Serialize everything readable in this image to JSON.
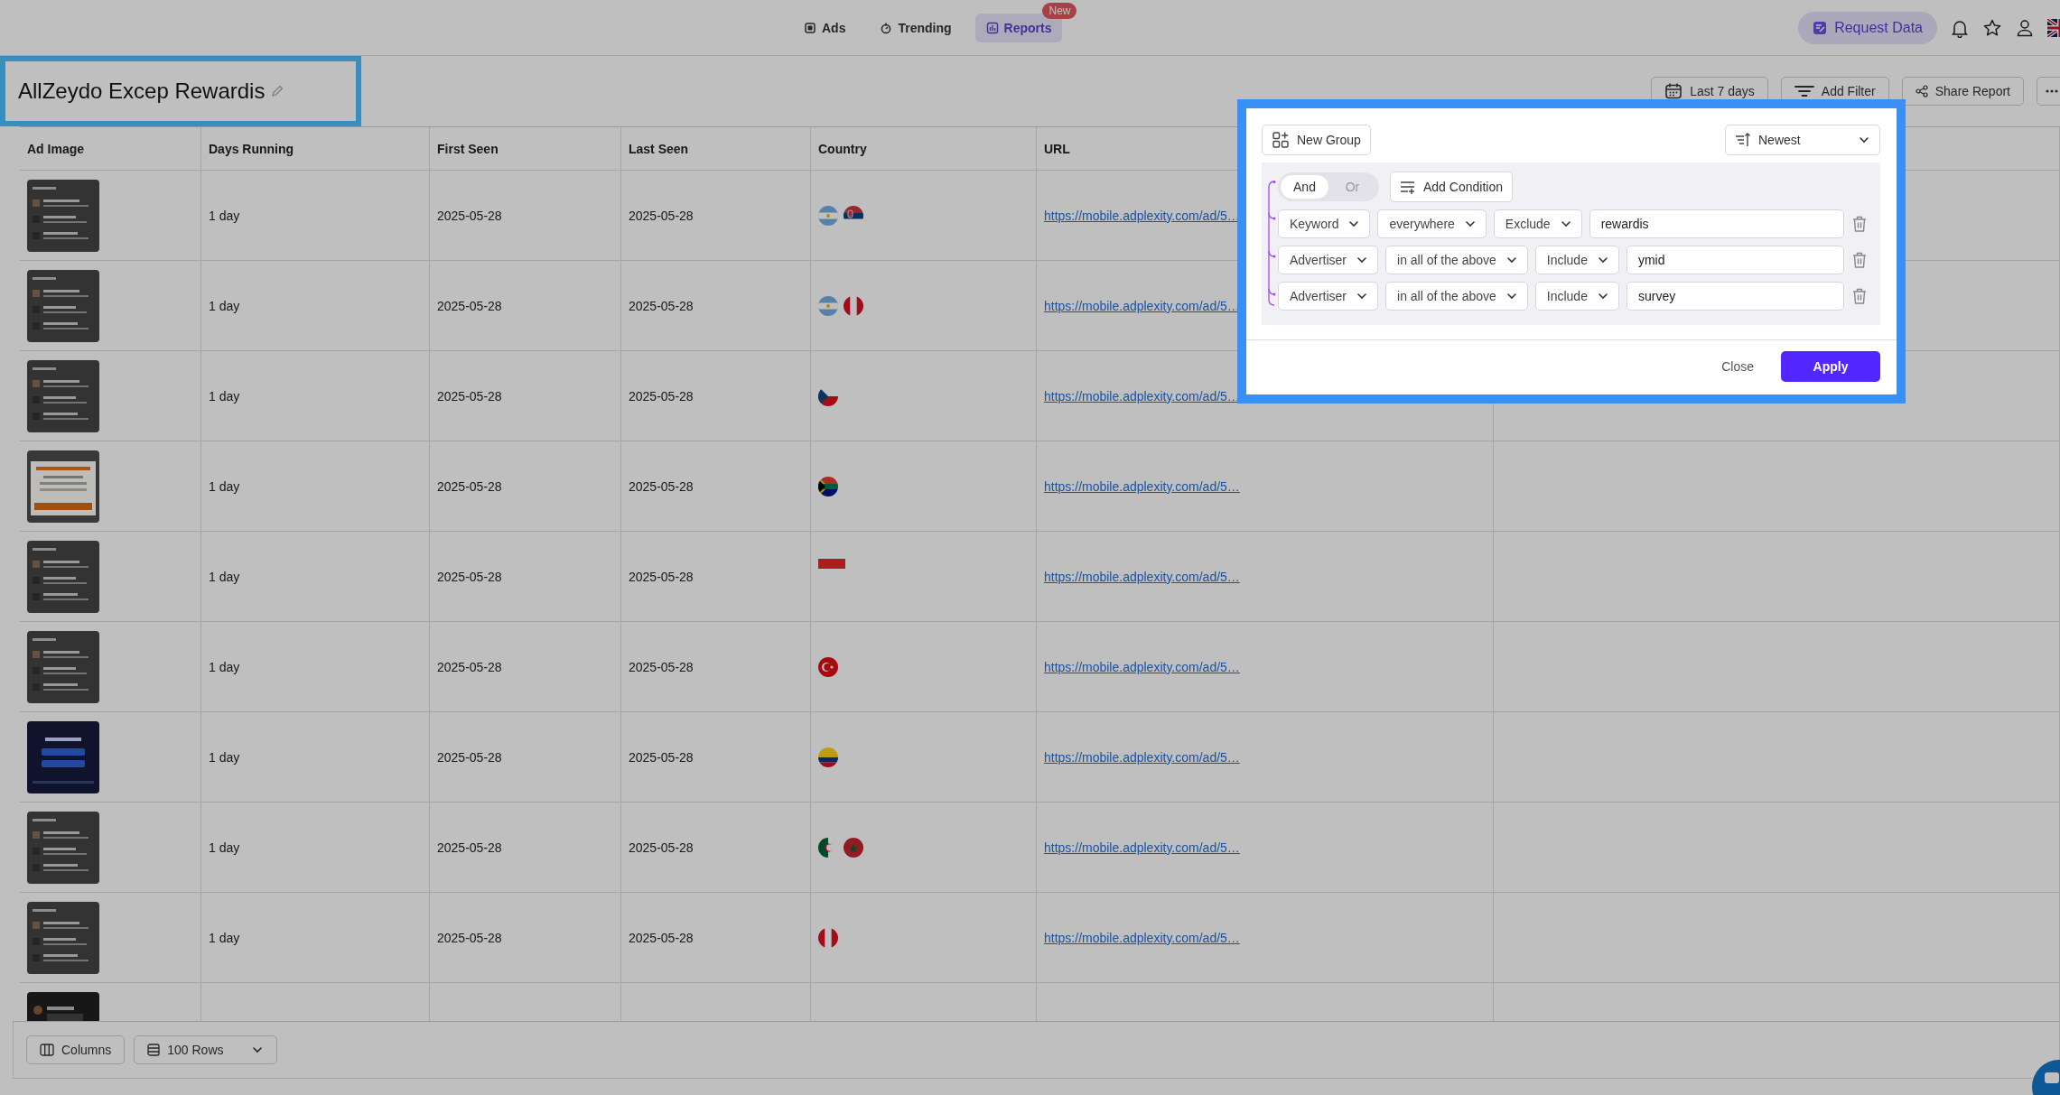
{
  "nav": {
    "tabs": [
      {
        "label": "Ads",
        "kind": "ads",
        "selected": false
      },
      {
        "label": "Trending",
        "kind": "trending",
        "selected": false
      },
      {
        "label": "Reports",
        "kind": "reports",
        "selected": true,
        "badge": "New"
      }
    ],
    "request_button": "Request Data"
  },
  "report": {
    "title": "AllZeydo Excep Rewardis",
    "date_range": "Last 7 days",
    "add_filter": "Add Filter",
    "share": "Share Report"
  },
  "table": {
    "columns": [
      "Ad Image",
      "Days Running",
      "First Seen",
      "Last Seen",
      "Country",
      "URL"
    ],
    "rows": [
      {
        "ad_image": {
          "kind": "picture"
        },
        "days": "1 day",
        "first_seen": "2025-05-28",
        "last_seen": "2025-05-28",
        "flags": [
          {
            "kind": "argentina"
          },
          {
            "kind": "serbia"
          }
        ],
        "url": "https://mobile.adplexity.com/ad/5…"
      },
      {
        "ad_image": {
          "kind": "picture"
        },
        "days": "1 day",
        "first_seen": "2025-05-28",
        "last_seen": "2025-05-28",
        "flags": [
          {
            "kind": "argentina"
          },
          {
            "kind": "peru"
          }
        ],
        "url": "https://mobile.adplexity.com/ad/5…"
      },
      {
        "ad_image": {
          "kind": "picture"
        },
        "days": "1 day",
        "first_seen": "2025-05-28",
        "last_seen": "2025-05-28",
        "flags": [
          {
            "kind": "czechia"
          }
        ],
        "url": "https://mobile.adplexity.com/ad/5…"
      },
      {
        "ad_image": {
          "kind": "picture"
        },
        "days": "1 day",
        "first_seen": "2025-05-28",
        "last_seen": "2025-05-28",
        "flags": [
          {
            "kind": "south_africa"
          }
        ],
        "url": "https://mobile.adplexity.com/ad/5…"
      },
      {
        "ad_image": {
          "kind": "picture"
        },
        "days": "1 day",
        "first_seen": "2025-05-28",
        "last_seen": "2025-05-28",
        "flags": [
          {
            "kind": "indonesia"
          }
        ],
        "url": "https://mobile.adplexity.com/ad/5…"
      },
      {
        "ad_image": {
          "kind": "picture"
        },
        "days": "1 day",
        "first_seen": "2025-05-28",
        "last_seen": "2025-05-28",
        "flags": [
          {
            "kind": "turkey"
          }
        ],
        "url": "https://mobile.adplexity.com/ad/5…"
      },
      {
        "ad_image": {
          "kind": "picture"
        },
        "days": "1 day",
        "first_seen": "2025-05-28",
        "last_seen": "2025-05-28",
        "flags": [
          {
            "kind": "colombia"
          }
        ],
        "url": "https://mobile.adplexity.com/ad/5…"
      },
      {
        "ad_image": {
          "kind": "picture"
        },
        "days": "1 day",
        "first_seen": "2025-05-28",
        "last_seen": "2025-05-28",
        "flags": [
          {
            "kind": "algeria"
          },
          {
            "kind": "morocco"
          }
        ],
        "url": "https://mobile.adplexity.com/ad/5…"
      },
      {
        "ad_image": {
          "kind": "picture"
        },
        "days": "1 day",
        "first_seen": "2025-05-28",
        "last_seen": "2025-05-28",
        "flags": [
          {
            "kind": "peru"
          }
        ],
        "url": "https://mobile.adplexity.com/ad/5…"
      },
      {
        "ad_image": {
          "kind": "picture"
        }
      }
    ]
  },
  "footer": {
    "columns_button": "Columns",
    "rows_select": "100 Rows"
  },
  "filter_popup": {
    "new_group": "New Group",
    "sort": "Newest",
    "logic": [
      {
        "label": "And",
        "selected": true
      },
      {
        "label": "Or",
        "selected": false
      }
    ],
    "add_condition": "Add Condition",
    "conditions": [
      {
        "field": "Keyword",
        "scope": "everywhere",
        "mode": "Exclude",
        "value": "rewardis"
      },
      {
        "field": "Advertiser",
        "scope": "in all of the above",
        "mode": "Include",
        "value": "ymid"
      },
      {
        "field": "Advertiser",
        "scope": "in all of the above",
        "mode": "Include",
        "value": "survey"
      }
    ],
    "close": "Close",
    "apply": "Apply"
  }
}
